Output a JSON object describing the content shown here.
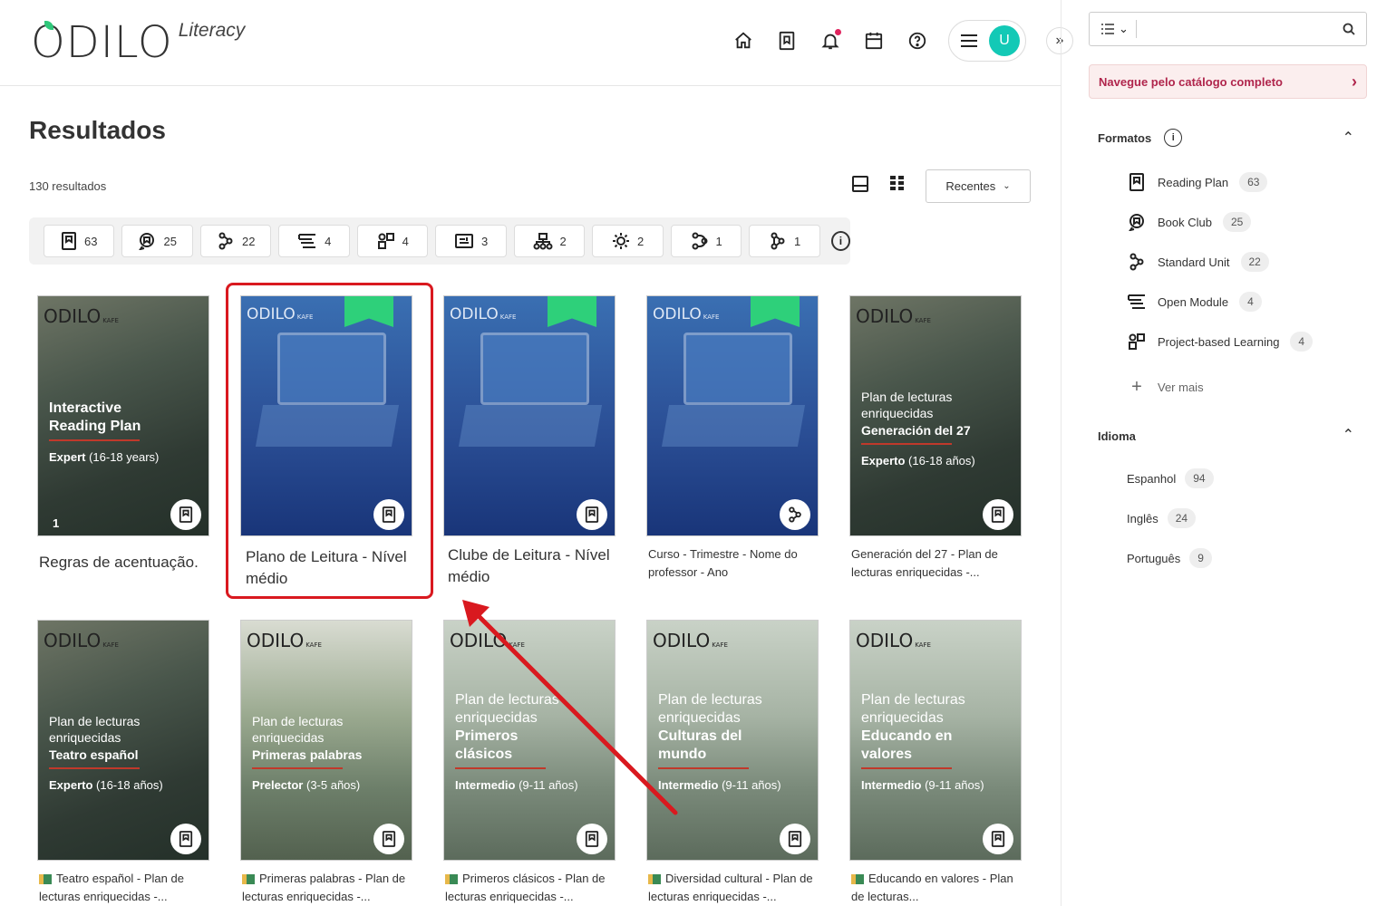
{
  "app": {
    "logo": "ODILO",
    "logo_sub": "Literacy",
    "avatar_initial": "U",
    "accent": "#13c9b6"
  },
  "header": {
    "icons": [
      "home-icon",
      "bookmark-icon",
      "bell-icon",
      "calendar-icon",
      "help-icon"
    ]
  },
  "results": {
    "title": "Resultados",
    "count": "130 resultados",
    "sort": "Recentes"
  },
  "filters": [
    {
      "icon": "reading-plan-icon",
      "count": "63"
    },
    {
      "icon": "book-club-icon",
      "count": "25"
    },
    {
      "icon": "standard-unit-icon",
      "count": "22"
    },
    {
      "icon": "open-module-icon",
      "count": "4"
    },
    {
      "icon": "project-based-icon",
      "count": "4"
    },
    {
      "icon": "format-icon-6",
      "count": "3"
    },
    {
      "icon": "format-icon-7",
      "count": "2"
    },
    {
      "icon": "format-icon-8",
      "count": "2"
    },
    {
      "icon": "format-icon-9",
      "count": "1"
    },
    {
      "icon": "format-icon-10",
      "count": "1"
    }
  ],
  "cards": [
    {
      "title": "Regras de acentuação.",
      "cover": {
        "brand": "ODILO",
        "line1": "Interactive",
        "line2": "Reading Plan",
        "level_b": "Expert",
        "level": " (16-18 years)",
        "num": "1"
      }
    },
    {
      "title": "Plano de Leitura - Nível médio"
    },
    {
      "title": "Clube de Leitura - Nível médio"
    },
    {
      "title": "Curso - Trimestre - Nome do professor - Ano"
    },
    {
      "title": "Generación del 27 - Plan de lecturas enriquecidas -...",
      "cover": {
        "brand": "ODILO",
        "line1": "Plan de lecturas",
        "line2": "enriquecidas",
        "line3": "Generación del 27",
        "level_b": "Experto",
        "level": " (16-18 años)"
      }
    },
    {
      "title": "Teatro español - Plan de lecturas enriquecidas -...",
      "cover": {
        "brand": "ODILO",
        "line1": "Plan de lecturas",
        "line2": "enriquecidas",
        "line3": "Teatro español",
        "level_b": "Experto",
        "level": " (16-18 años)"
      }
    },
    {
      "title": "Primeras palabras - Plan de lecturas enriquecidas -...",
      "cover": {
        "brand": "ODILO",
        "line1": "Plan de lecturas",
        "line2": "enriquecidas",
        "line3": "Primeras palabras",
        "level_b": "Prelector",
        "level": " (3-5 años)"
      }
    },
    {
      "title": "Primeros clásicos - Plan de lecturas enriquecidas -...",
      "cover": {
        "brand": "ODILO",
        "line1": "Plan de lecturas",
        "line2": "enriquecidas",
        "line3": "Primeros clásicos",
        "level_b": "Intermedio",
        "level": " (9-11 años)"
      }
    },
    {
      "title": "Diversidad cultural - Plan de lecturas enriquecidas -...",
      "cover": {
        "brand": "ODILO",
        "line1": "Plan de lecturas",
        "line2": "enriquecidas",
        "line3": "Culturas del mundo",
        "level_b": "Intermedio",
        "level": " (9-11 años)"
      }
    },
    {
      "title": "Educando en valores - Plan de lecturas...",
      "cover": {
        "brand": "ODILO",
        "line1": "Plan de lecturas",
        "line2": "enriquecidas",
        "line3": "Educando en valores",
        "level_b": "Intermedio",
        "level": " (9-11 años)"
      }
    }
  ],
  "sidebar": {
    "search_placeholder": "",
    "catalog_link": "Navegue pelo catálogo completo",
    "formats_title": "Formatos",
    "formats": [
      {
        "label": "Reading Plan",
        "count": "63"
      },
      {
        "label": "Book Club",
        "count": "25"
      },
      {
        "label": "Standard Unit",
        "count": "22"
      },
      {
        "label": "Open Module",
        "count": "4"
      },
      {
        "label": "Project-based Learning",
        "count": "4"
      }
    ],
    "more": "Ver mais",
    "language_title": "Idioma",
    "languages": [
      {
        "label": "Espanhol",
        "count": "94"
      },
      {
        "label": "Inglês",
        "count": "24"
      },
      {
        "label": "Português",
        "count": "9"
      }
    ]
  },
  "annotation_color": "#d9191f"
}
